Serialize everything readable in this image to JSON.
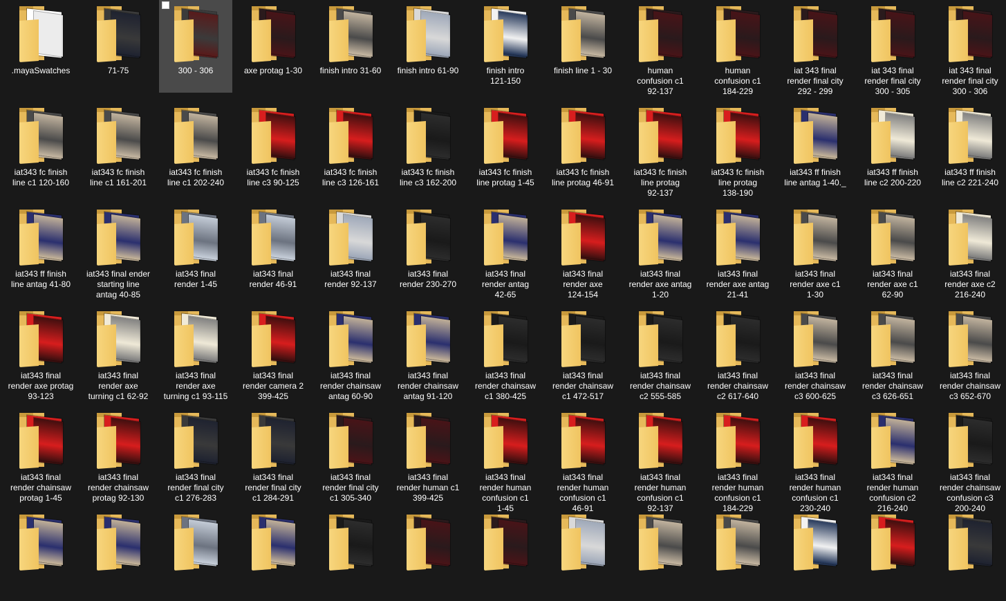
{
  "window": {
    "view": "Large icons",
    "selected_item": "300 - 306"
  },
  "items": [
    {
      "label": ".mayaSwatches",
      "thumb": "doc",
      "selected": false
    },
    {
      "label": "71-75",
      "thumb": "dark-room",
      "selected": false
    },
    {
      "label": "300 - 306",
      "thumb": "dark-car",
      "selected": true
    },
    {
      "label": "axe protag 1-30",
      "thumb": "dark-red",
      "selected": false
    },
    {
      "label": "finish intro 31-60",
      "thumb": "grey-city",
      "selected": false
    },
    {
      "label": "finish intro 61-90",
      "thumb": "white-city",
      "selected": false
    },
    {
      "label": "finish intro\n121-150",
      "thumb": "blue-white",
      "selected": false
    },
    {
      "label": "finish line 1 - 30",
      "thumb": "grey-city",
      "selected": false
    },
    {
      "label": "human\nconfusion c1\n92-137",
      "thumb": "dark-red",
      "selected": false
    },
    {
      "label": "human\nconfusion c1\n184-229",
      "thumb": "dark-red",
      "selected": false
    },
    {
      "label": "iat 343 final\nrender final city\n292 - 299",
      "thumb": "dark-red",
      "selected": false
    },
    {
      "label": "iat 343 final\nrender final city\n300 - 305",
      "thumb": "dark-red",
      "selected": false
    },
    {
      "label": "iat 343 final\nrender final city\n300 - 306",
      "thumb": "dark-red",
      "selected": false
    },
    {
      "label": "iat343 fc finish\nline c1 120-160",
      "thumb": "grey-city",
      "selected": false
    },
    {
      "label": "iat343 fc finish\nline c1 161-201",
      "thumb": "grey-city",
      "selected": false
    },
    {
      "label": "iat343 fc finish\nline c1 202-240",
      "thumb": "grey-city",
      "selected": false
    },
    {
      "label": "iat343 fc finish\nline c3 90-125",
      "thumb": "red",
      "selected": false
    },
    {
      "label": "iat343 fc finish\nline c3 126-161",
      "thumb": "red",
      "selected": false
    },
    {
      "label": "iat343 fc finish\nline c3 162-200",
      "thumb": "dark",
      "selected": false
    },
    {
      "label": "iat343 fc finish\nline protag 1-45",
      "thumb": "red",
      "selected": false
    },
    {
      "label": "iat343 fc finish\nline protag 46-91",
      "thumb": "red",
      "selected": false
    },
    {
      "label": "iat343 fc finish\nline protag\n92-137",
      "thumb": "red",
      "selected": false
    },
    {
      "label": "iat343 fc finish\nline protag\n138-190",
      "thumb": "red",
      "selected": false
    },
    {
      "label": "iat343 ff finish\nline antag 1-40._",
      "thumb": "blue",
      "selected": false
    },
    {
      "label": "iat343 ff finish\nline c2 200-220",
      "thumb": "light-city",
      "selected": false
    },
    {
      "label": "iat343 ff finish\nline c2 221-240",
      "thumb": "light-city",
      "selected": false
    },
    {
      "label": "iat343 ff finish\nline antag 41-80",
      "thumb": "blue",
      "selected": false
    },
    {
      "label": "iat343 final ender\nstarting line\nantag 40-85",
      "thumb": "blue",
      "selected": false
    },
    {
      "label": "iat343 final\nrender 1-45",
      "thumb": "glitch",
      "selected": false
    },
    {
      "label": "iat343 final\nrender 46-91",
      "thumb": "glitch",
      "selected": false
    },
    {
      "label": "iat343 final\nrender 92-137",
      "thumb": "white-city",
      "selected": false
    },
    {
      "label": "iat343 final\nrender 230-270",
      "thumb": "dark",
      "selected": false
    },
    {
      "label": "iat343 final\nrender antag\n42-65",
      "thumb": "blue",
      "selected": false
    },
    {
      "label": "iat343 final\nrender axe\n124-154",
      "thumb": "red",
      "selected": false
    },
    {
      "label": "iat343 final\nrender axe antag\n1-20",
      "thumb": "blue",
      "selected": false
    },
    {
      "label": "iat343 final\nrender axe antag\n21-41",
      "thumb": "blue",
      "selected": false
    },
    {
      "label": "iat343 final\nrender axe c1\n1-30",
      "thumb": "grey-city",
      "selected": false
    },
    {
      "label": "iat343 final\nrender axe c1\n62-90",
      "thumb": "grey-city",
      "selected": false
    },
    {
      "label": "iat343 final\nrender axe c2\n216-240",
      "thumb": "light-city",
      "selected": false
    },
    {
      "label": "iat343 final\nrender axe protag\n93-123",
      "thumb": "red",
      "selected": false
    },
    {
      "label": "iat343 final\nrender axe\nturning c1 62-92",
      "thumb": "light-city",
      "selected": false
    },
    {
      "label": "iat343 final\nrender axe\nturning c1 93-115",
      "thumb": "light-city",
      "selected": false
    },
    {
      "label": "iat343 final\nrender camera 2\n399-425",
      "thumb": "red",
      "selected": false
    },
    {
      "label": "iat343 final\nrender chainsaw\nantag 60-90",
      "thumb": "blue",
      "selected": false
    },
    {
      "label": "iat343 final\nrender chainsaw\nantag 91-120",
      "thumb": "blue",
      "selected": false
    },
    {
      "label": "iat343 final\nrender chainsaw\nc1 380-425",
      "thumb": "dark",
      "selected": false
    },
    {
      "label": "iat343 final\nrender chainsaw\nc1 472-517",
      "thumb": "dark",
      "selected": false
    },
    {
      "label": "iat343 final\nrender chainsaw\nc2 555-585",
      "thumb": "dark",
      "selected": false
    },
    {
      "label": "iat343 final\nrender chainsaw\nc2 617-640",
      "thumb": "dark",
      "selected": false
    },
    {
      "label": "iat343 final\nrender chainsaw\nc3 600-625",
      "thumb": "grey-city",
      "selected": false
    },
    {
      "label": "iat343 final\nrender chainsaw\nc3 626-651",
      "thumb": "grey-city",
      "selected": false
    },
    {
      "label": "iat343 final\nrender chainsaw\nc3 652-670",
      "thumb": "grey-city",
      "selected": false
    },
    {
      "label": "iat343 final\nrender chainsaw\nprotag 1-45",
      "thumb": "red",
      "selected": false
    },
    {
      "label": "iat343 final\nrender chainsaw\nprotag 92-130",
      "thumb": "red",
      "selected": false
    },
    {
      "label": "iat343 final\nrender final city\nc1 276-283",
      "thumb": "dark-room",
      "selected": false
    },
    {
      "label": "iat343 final\nrender final city\nc1 284-291",
      "thumb": "dark-room",
      "selected": false
    },
    {
      "label": "iat343 final\nrender final city\nc1 305-340",
      "thumb": "dark-red",
      "selected": false
    },
    {
      "label": "iat343 final\nrender human c1\n399-425",
      "thumb": "dark-red",
      "selected": false
    },
    {
      "label": "iat343 final\nrender human\nconfusion c1\n1-45",
      "thumb": "red",
      "selected": false
    },
    {
      "label": "iat343 final\nrender human\nconfusion c1\n46-91",
      "thumb": "red",
      "selected": false
    },
    {
      "label": "iat343 final\nrender human\nconfusion c1\n92-137",
      "thumb": "red",
      "selected": false
    },
    {
      "label": "iat343 final\nrender human\nconfusion c1\n184-229",
      "thumb": "red",
      "selected": false
    },
    {
      "label": "iat343 final\nrender human\nconfusion c1\n230-240",
      "thumb": "red",
      "selected": false
    },
    {
      "label": "iat343 final\nrender human\nconfusion c2\n216-240",
      "thumb": "blue",
      "selected": false
    },
    {
      "label": "iat343 final\nrender chainsaw\nconfusion c3\n200-240",
      "thumb": "dark",
      "selected": false
    },
    {
      "label": "",
      "thumb": "blue",
      "selected": false
    },
    {
      "label": "",
      "thumb": "blue",
      "selected": false
    },
    {
      "label": "",
      "thumb": "glitch",
      "selected": false
    },
    {
      "label": "",
      "thumb": "blue",
      "selected": false
    },
    {
      "label": "",
      "thumb": "dark",
      "selected": false
    },
    {
      "label": "",
      "thumb": "dark-red",
      "selected": false
    },
    {
      "label": "",
      "thumb": "dark-red",
      "selected": false
    },
    {
      "label": "",
      "thumb": "white-city",
      "selected": false
    },
    {
      "label": "",
      "thumb": "grey-city",
      "selected": false
    },
    {
      "label": "",
      "thumb": "grey-city",
      "selected": false
    },
    {
      "label": "",
      "thumb": "blue-white",
      "selected": false
    },
    {
      "label": "",
      "thumb": "red",
      "selected": false
    },
    {
      "label": "",
      "thumb": "dark-room",
      "selected": false
    }
  ],
  "thumb_colors": {
    "doc": [
      "#ffffff",
      "#e8e8e8"
    ],
    "dark-room": [
      "#3a3a3a",
      "#1e2230"
    ],
    "dark-car": [
      "#3b3b3b",
      "#5a1a1a"
    ],
    "dark-red": [
      "#2a1a1c",
      "#4a1418"
    ],
    "grey-city": [
      "#4a4a4a",
      "#c8b9a3"
    ],
    "white-city": [
      "#d9d9d9",
      "#9da7b8"
    ],
    "blue-white": [
      "#f2f2f2",
      "#1f3255"
    ],
    "dark": [
      "#1a1a1a",
      "#2d2d2d"
    ],
    "red": [
      "#d81e1e",
      "#3a0f0f"
    ],
    "blue": [
      "#2a2f6e",
      "#c9b79a"
    ],
    "light-city": [
      "#f0ead8",
      "#7d7d7d"
    ],
    "glitch": [
      "#6c7380",
      "#c9d1dc"
    ]
  }
}
